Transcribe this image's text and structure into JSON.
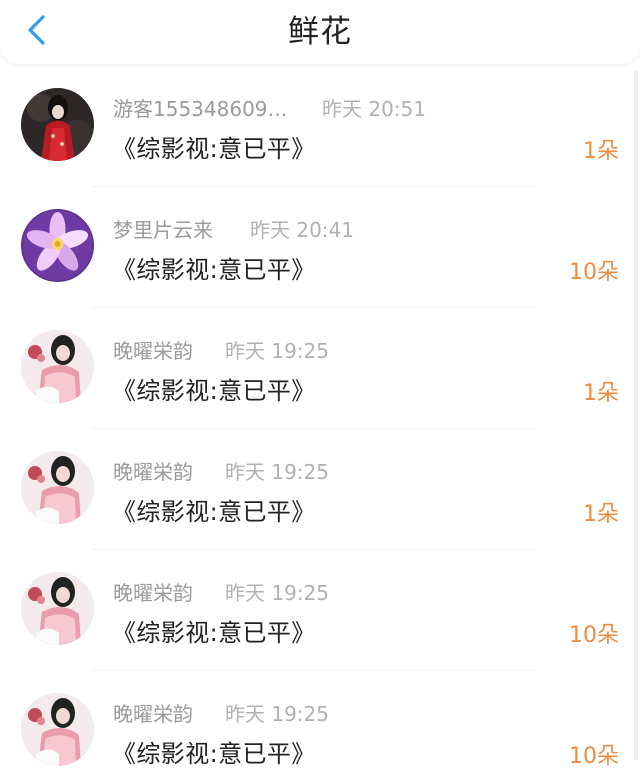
{
  "header": {
    "title": "鲜花",
    "back_icon": "chevron-left-icon"
  },
  "colors": {
    "accent": "#2f9cf0",
    "count": "#ef8b3d",
    "username": "#9a9a9a",
    "time": "#b1b1b1",
    "text": "#222222"
  },
  "rows": [
    {
      "avatar": "avatar-woman-red-dress",
      "username": "游客155348609…",
      "time": "昨天 20:51",
      "work": "《综影视:意已平》",
      "count": "1朵"
    },
    {
      "avatar": "avatar-purple-flower",
      "username": "梦里片云来",
      "time": "昨天 20:41",
      "work": "《综影视:意已平》",
      "count": "10朵"
    },
    {
      "avatar": "avatar-girl-pink-outfit",
      "username": "晚曜栄韵",
      "time": "昨天 19:25",
      "work": "《综影视:意已平》",
      "count": "1朵"
    },
    {
      "avatar": "avatar-girl-pink-outfit",
      "username": "晚曜栄韵",
      "time": "昨天 19:25",
      "work": "《综影视:意已平》",
      "count": "1朵"
    },
    {
      "avatar": "avatar-girl-pink-outfit",
      "username": "晚曜栄韵",
      "time": "昨天 19:25",
      "work": "《综影视:意已平》",
      "count": "10朵"
    },
    {
      "avatar": "avatar-girl-pink-outfit",
      "username": "晚曜栄韵",
      "time": "昨天 19:25",
      "work": "《综影视:意已平》",
      "count": "10朵"
    }
  ]
}
